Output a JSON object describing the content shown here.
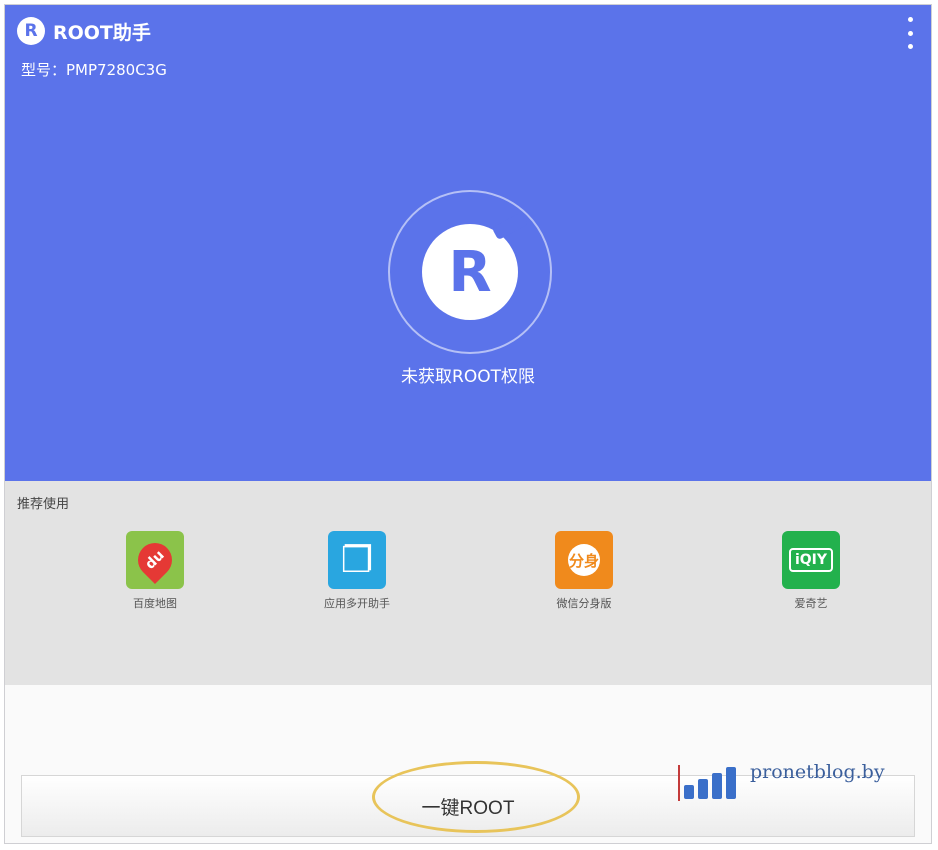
{
  "app": {
    "title": "ROOT助手",
    "logo_letter": "R",
    "model": "型号：PMP7280C3G"
  },
  "hero": {
    "center_letter": "R",
    "status": "未获取ROOT权限",
    "color": "#5b73ea"
  },
  "recommend": {
    "title": "推荐使用",
    "apps": [
      {
        "label": "百度地图",
        "glyph": "du",
        "icon": "map-pin-icon",
        "color": "#8bc34a"
      },
      {
        "label": "应用多开助手",
        "glyph": "❐",
        "icon": "clone-icon",
        "color": "#29a6e0"
      },
      {
        "label": "微信分身版",
        "glyph": "分身",
        "icon": "clone-chat-icon",
        "color": "#f08a1c"
      },
      {
        "label": "爱奇艺",
        "glyph": "iQIY",
        "icon": "iqiyi-icon",
        "color": "#23b14d"
      }
    ]
  },
  "action": {
    "button_label": "一键ROOT"
  },
  "watermark": {
    "text": "pronetblog.by"
  }
}
